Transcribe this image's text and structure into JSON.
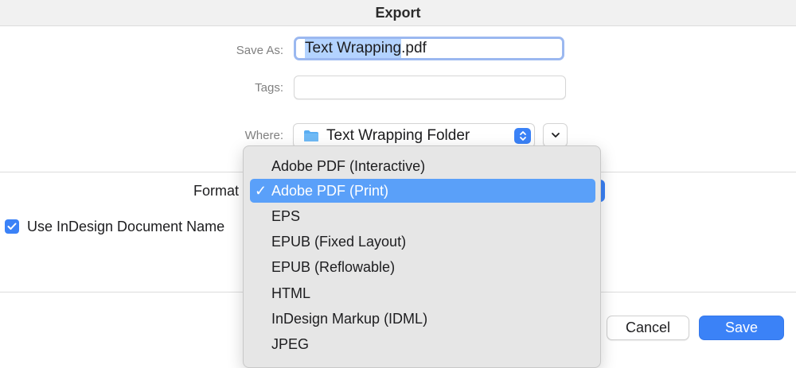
{
  "window": {
    "title": "Export"
  },
  "save_as": {
    "label": "Save As:",
    "filename_selected": "Text Wrapping",
    "filename_ext": ".pdf"
  },
  "tags": {
    "label": "Tags:",
    "value": ""
  },
  "where": {
    "label": "Where:",
    "folder": "Text Wrapping Folder"
  },
  "format": {
    "label": "Format"
  },
  "use_name": {
    "label": "Use InDesign Document Name",
    "checked": true
  },
  "format_menu": {
    "items": [
      {
        "label": "Adobe PDF (Interactive)",
        "selected": false
      },
      {
        "label": "Adobe PDF (Print)",
        "selected": true
      },
      {
        "label": "EPS",
        "selected": false
      },
      {
        "label": "EPUB (Fixed Layout)",
        "selected": false
      },
      {
        "label": "EPUB (Reflowable)",
        "selected": false
      },
      {
        "label": "HTML",
        "selected": false
      },
      {
        "label": "InDesign Markup (IDML)",
        "selected": false
      },
      {
        "label": "JPEG",
        "selected": false
      }
    ],
    "check_symbol": "✓"
  },
  "buttons": {
    "cancel": "Cancel",
    "save": "Save"
  },
  "colors": {
    "accent": "#3b82f7",
    "menu_highlight": "#5aa0f9",
    "selection": "#b3d3ff"
  }
}
